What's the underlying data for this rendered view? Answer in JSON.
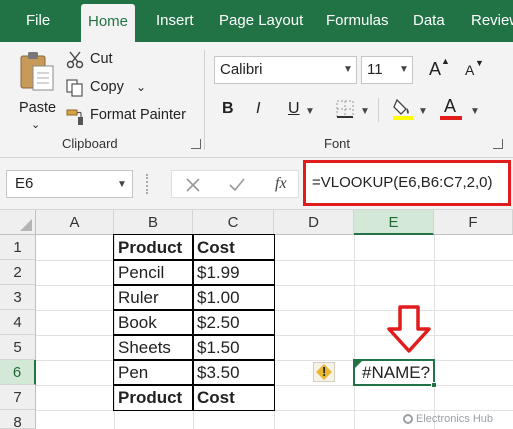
{
  "tabs": [
    "File",
    "Home",
    "Insert",
    "Page Layout",
    "Formulas",
    "Data",
    "Review"
  ],
  "clipboard": {
    "paste": "Paste",
    "cut": "Cut",
    "copy": "Copy",
    "format_painter": "Format Painter",
    "group_label": "Clipboard"
  },
  "font": {
    "family": "Calibri",
    "size": "11",
    "group_label": "Font",
    "bold": "B",
    "italic": "I",
    "underline": "U",
    "font_color_letter": "A",
    "grow": "A",
    "shrink": "A"
  },
  "formula_bar": {
    "name_box": "E6",
    "fx": "fx",
    "formula": "=VLOOKUP(E6,B6:C7,2,0)"
  },
  "grid": {
    "columns": [
      "A",
      "B",
      "C",
      "D",
      "E",
      "F"
    ],
    "rows": [
      "1",
      "2",
      "3",
      "4",
      "5",
      "6",
      "7",
      "8"
    ],
    "selected_column": "E",
    "selected_row": "6",
    "table": [
      {
        "product": "Product",
        "cost": "Cost"
      },
      {
        "product": "Pencil",
        "cost": "$1.99"
      },
      {
        "product": "Ruler",
        "cost": "$1.00"
      },
      {
        "product": "Book",
        "cost": "$2.50"
      },
      {
        "product": "Sheets",
        "cost": "$1.50"
      },
      {
        "product": "Pen",
        "cost": "$3.50"
      },
      {
        "product": "Product",
        "cost": "Cost"
      }
    ],
    "active_cell_value": "#NAME?",
    "warning_glyph": "!"
  },
  "watermark": "Electronics Hub",
  "colors": {
    "ribbon_green": "#217346",
    "highlight_red": "#e01c1c",
    "highlight_yellow": "#ffff00"
  },
  "icons": [
    "paste-icon",
    "cut-icon",
    "copy-icon",
    "format-painter-icon",
    "borders-icon",
    "fill-color-icon",
    "font-color-icon",
    "cancel-icon",
    "enter-icon",
    "warning-icon",
    "red-arrow"
  ]
}
